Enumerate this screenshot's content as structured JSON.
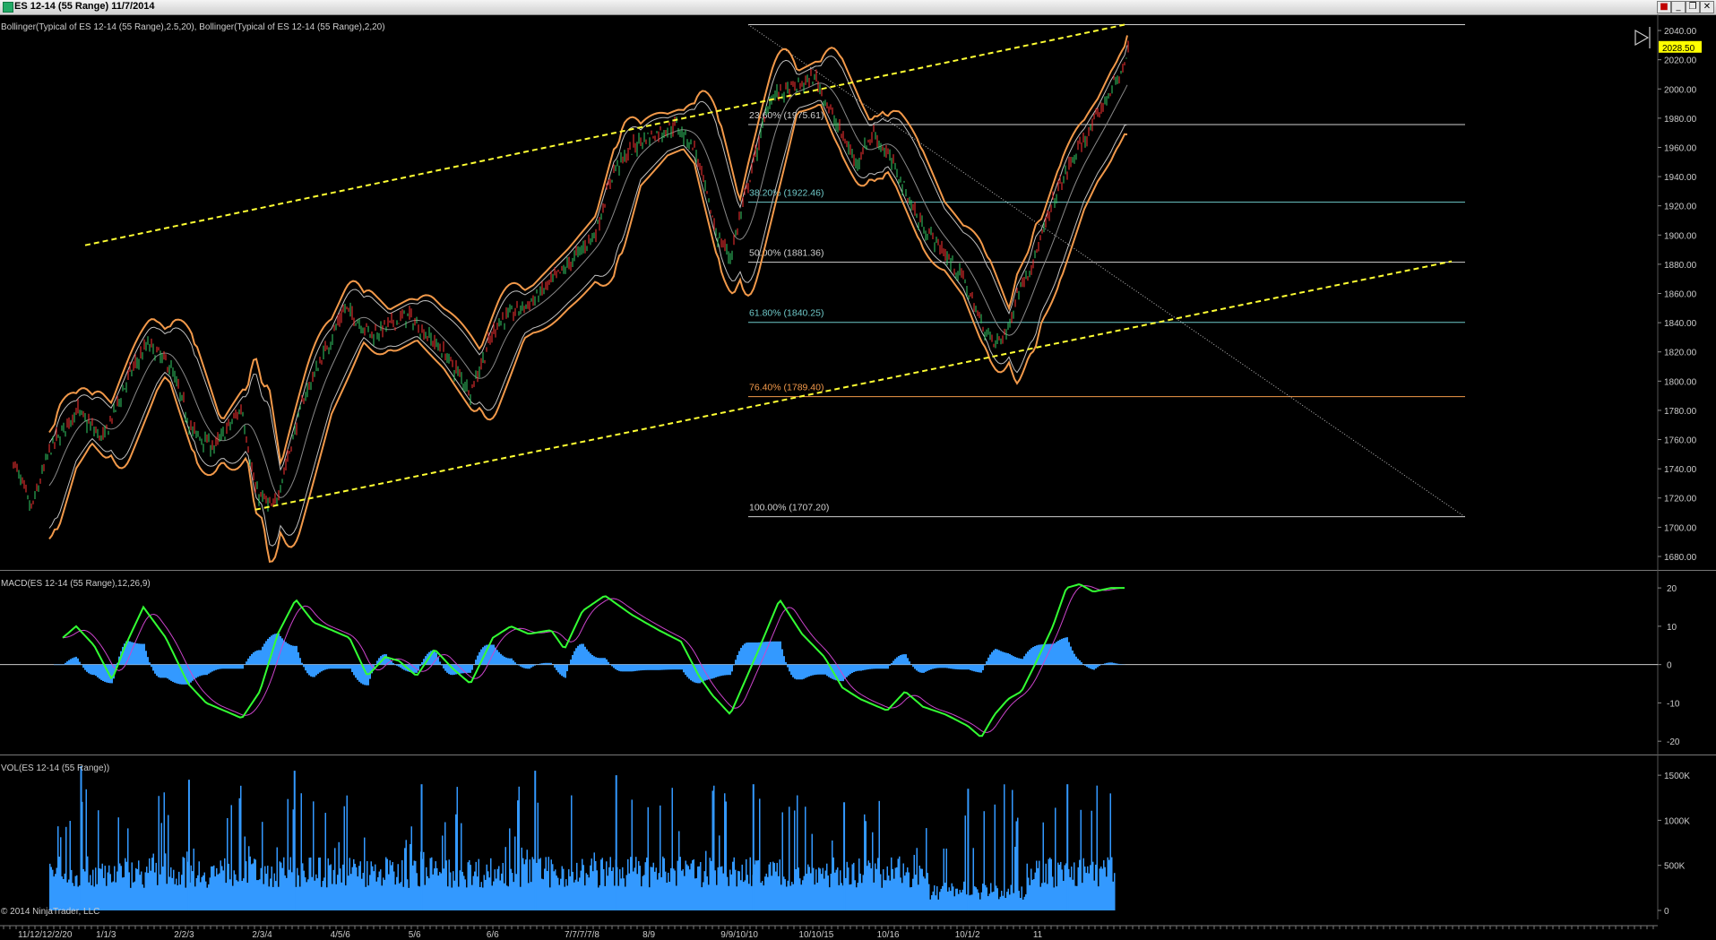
{
  "window": {
    "title": "ES 12-14 (55 Range)  11/7/2014",
    "buttons": [
      {
        "name": "alert-button",
        "glyph": "■",
        "color": "#c00000"
      },
      {
        "name": "minimize-button",
        "glyph": "_",
        "color": "#000000"
      },
      {
        "name": "restore-button",
        "glyph": "❐",
        "color": "#000000"
      },
      {
        "name": "close-button",
        "glyph": "✕",
        "color": "#000000"
      }
    ]
  },
  "colors": {
    "background": "#000000",
    "bollinger_outer": "#f2994a",
    "bollinger_inner": "#bfbfbf",
    "channel": "#ffff33",
    "fib_white": "#cfcfcf",
    "fib_teal": "#6fc9c9",
    "fib_orange": "#f2994a",
    "macd_line": "#33ff33",
    "macd_signal": "#cc44cc",
    "macd_hist": "#3399ff",
    "volume": "#3399ff",
    "up_candle": "#33cc66",
    "down_candle": "#ff3333",
    "price_tag": "#ffff00"
  },
  "chart_data": [
    {
      "type": "line",
      "panel": "price",
      "indicator_label": "Bollinger(Typical of ES 12-14 (55 Range),2.5,20), Bollinger(Typical of ES 12-14 (55 Range),2,20)",
      "y_ticks": [
        "2040.00",
        "2020.00",
        "2000.00",
        "1980.00",
        "1960.00",
        "1940.00",
        "1920.00",
        "1900.00",
        "1880.00",
        "1860.00",
        "1840.00",
        "1820.00",
        "1800.00",
        "1780.00",
        "1760.00",
        "1740.00",
        "1720.00",
        "1700.00",
        "1680.00"
      ],
      "ylim": [
        1672,
        2048
      ],
      "last_price": "2028.50",
      "x_bars": 1200,
      "price_path": [
        [
          0,
          1745
        ],
        [
          20,
          1712
        ],
        [
          40,
          1752
        ],
        [
          70,
          1780
        ],
        [
          100,
          1760
        ],
        [
          130,
          1805
        ],
        [
          150,
          1825
        ],
        [
          175,
          1810
        ],
        [
          200,
          1765
        ],
        [
          225,
          1755
        ],
        [
          255,
          1782
        ],
        [
          270,
          1725
        ],
        [
          290,
          1712
        ],
        [
          325,
          1790
        ],
        [
          370,
          1850
        ],
        [
          400,
          1832
        ],
        [
          440,
          1845
        ],
        [
          480,
          1820
        ],
        [
          510,
          1793
        ],
        [
          540,
          1840
        ],
        [
          580,
          1855
        ],
        [
          620,
          1880
        ],
        [
          650,
          1902
        ],
        [
          670,
          1945
        ],
        [
          700,
          1965
        ],
        [
          740,
          1975
        ],
        [
          760,
          1960
        ],
        [
          785,
          1900
        ],
        [
          800,
          1885
        ],
        [
          820,
          1935
        ],
        [
          845,
          1995
        ],
        [
          870,
          2000
        ],
        [
          895,
          2008
        ],
        [
          915,
          1980
        ],
        [
          940,
          1950
        ],
        [
          960,
          1970
        ],
        [
          985,
          1945
        ],
        [
          1010,
          1910
        ],
        [
          1030,
          1895
        ],
        [
          1060,
          1870
        ],
        [
          1080,
          1840
        ],
        [
          1095,
          1825
        ],
        [
          1110,
          1835
        ],
        [
          1120,
          1860
        ],
        [
          1140,
          1885
        ],
        [
          1165,
          1930
        ],
        [
          1185,
          1955
        ],
        [
          1205,
          1975
        ],
        [
          1225,
          2000
        ],
        [
          1240,
          2015
        ],
        [
          1245,
          2030
        ]
      ],
      "fibonacci": [
        {
          "label": "23.60% (1975.61)",
          "level": 1975.61,
          "color": "fib_white"
        },
        {
          "label": "38.20% (1922.46)",
          "level": 1922.46,
          "color": "fib_teal"
        },
        {
          "label": "50.00% (1881.36)",
          "level": 1881.36,
          "color": "fib_white"
        },
        {
          "label": "61.80% (1840.25)",
          "level": 1840.25,
          "color": "fib_teal"
        },
        {
          "label": "76.40% (1789.40)",
          "level": 1789.4,
          "color": "fib_orange"
        },
        {
          "label": "100.00% (1707.20)",
          "level": 1707.2,
          "color": "fib_white"
        }
      ],
      "fib_top": 2044,
      "fib_x": [
        820,
        1620
      ],
      "channel_upper": [
        [
          80,
          1893
        ],
        [
          1240,
          2044
        ]
      ],
      "channel_lower": [
        [
          270,
          1712
        ],
        [
          1605,
          1882
        ]
      ],
      "diagonal": [
        [
          820,
          2044
        ],
        [
          1620,
          1707
        ]
      ]
    },
    {
      "type": "line",
      "panel": "macd",
      "indicator_label": "MACD(ES 12-14 (55 Range),12,26,9)",
      "y_ticks": [
        "20",
        "10",
        "0",
        "-10",
        "-20"
      ],
      "ylim": [
        -23,
        24
      ],
      "macd_path": [
        [
          55,
          7
        ],
        [
          70,
          10
        ],
        [
          90,
          5
        ],
        [
          110,
          -4
        ],
        [
          125,
          5
        ],
        [
          145,
          15
        ],
        [
          170,
          7
        ],
        [
          195,
          -5
        ],
        [
          215,
          -10
        ],
        [
          235,
          -12
        ],
        [
          255,
          -14
        ],
        [
          275,
          -7
        ],
        [
          295,
          8
        ],
        [
          315,
          17
        ],
        [
          335,
          11
        ],
        [
          355,
          9
        ],
        [
          375,
          7
        ],
        [
          395,
          -3
        ],
        [
          415,
          2
        ],
        [
          430,
          1
        ],
        [
          450,
          -3
        ],
        [
          470,
          4
        ],
        [
          490,
          -1
        ],
        [
          510,
          -5
        ],
        [
          535,
          7
        ],
        [
          555,
          10
        ],
        [
          575,
          8
        ],
        [
          600,
          9
        ],
        [
          615,
          4
        ],
        [
          635,
          14
        ],
        [
          660,
          18
        ],
        [
          690,
          13
        ],
        [
          720,
          9
        ],
        [
          745,
          6
        ],
        [
          765,
          -3
        ],
        [
          780,
          -8
        ],
        [
          800,
          -13
        ],
        [
          830,
          3
        ],
        [
          855,
          17
        ],
        [
          880,
          8
        ],
        [
          905,
          2
        ],
        [
          925,
          -6
        ],
        [
          945,
          -9
        ],
        [
          975,
          -12
        ],
        [
          995,
          -7
        ],
        [
          1015,
          -11
        ],
        [
          1040,
          -13
        ],
        [
          1065,
          -16
        ],
        [
          1080,
          -19
        ],
        [
          1095,
          -13
        ],
        [
          1110,
          -9
        ],
        [
          1125,
          -7
        ],
        [
          1140,
          0
        ],
        [
          1160,
          10
        ],
        [
          1175,
          20
        ],
        [
          1190,
          21
        ],
        [
          1205,
          19
        ],
        [
          1225,
          20
        ],
        [
          1240,
          20
        ]
      ],
      "hist_amp": 6
    },
    {
      "type": "bar",
      "panel": "volume",
      "indicator_label": "VOL(ES 12-14 (55 Range))",
      "y_ticks": [
        "1500K",
        "1000K",
        "500K",
        "0"
      ],
      "ylim": [
        0,
        1700
      ],
      "peak_values_k": [
        1600,
        1450,
        1550,
        1400,
        1550,
        1500,
        1400,
        1200,
        1350,
        1400
      ]
    }
  ],
  "x_axis_labels": [
    "11/12/12/2/20",
    "1/1/3",
    "2/2/3",
    "2/3/4",
    "4/5/6",
    "5/6",
    "6/6",
    "7/7/7/7/8",
    "8/9",
    "9/9/10/10",
    "10/10/15",
    "10/16",
    "10/1/2",
    "11"
  ],
  "copyright": "© 2014 NinjaTrader, LLC"
}
